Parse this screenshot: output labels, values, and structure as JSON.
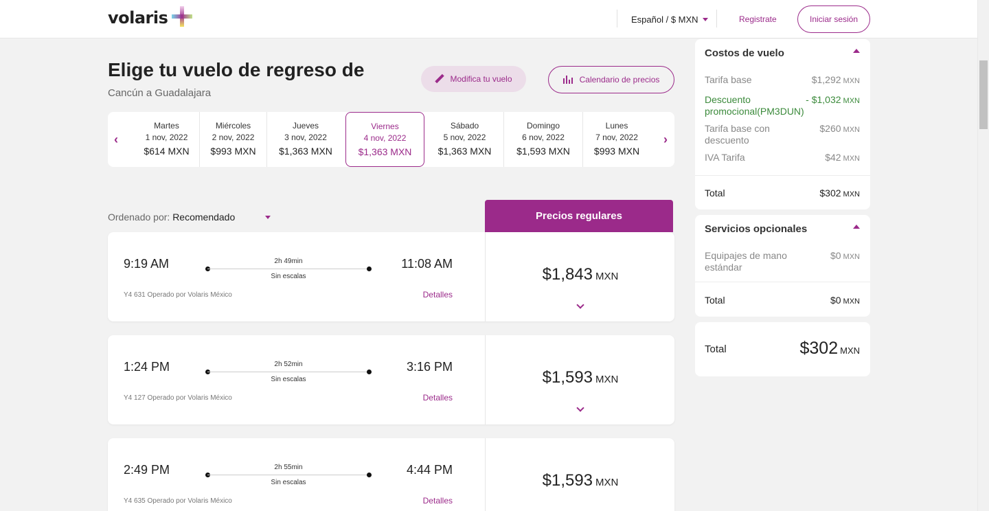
{
  "header": {
    "logo_text": "volaris",
    "language": "Español / $ MXN",
    "register": "Registrate",
    "login": "Iniciar sesión"
  },
  "page": {
    "title": "Elige tu vuelo de regreso de",
    "route": "Cancún a Guadalajara",
    "modify_btn": "Modifica tu vuelo",
    "calendar_btn": "Calendario de precios"
  },
  "dates": [
    {
      "day": "Martes",
      "date": "1 nov, 2022",
      "price": "$614 MXN"
    },
    {
      "day": "Miércoles",
      "date": "2 nov, 2022",
      "price": "$993 MXN"
    },
    {
      "day": "Jueves",
      "date": "3 nov, 2022",
      "price": "$1,363 MXN"
    },
    {
      "day": "Viernes",
      "date": "4 nov, 2022",
      "price": "$1,363 MXN"
    },
    {
      "day": "Sábado",
      "date": "5 nov, 2022",
      "price": "$1,363 MXN"
    },
    {
      "day": "Domingo",
      "date": "6 nov, 2022",
      "price": "$1,593 MXN"
    },
    {
      "day": "Lunes",
      "date": "7 nov, 2022",
      "price": "$993 MXN"
    }
  ],
  "sort": {
    "label": "Ordenado por:",
    "value": "Recomendado"
  },
  "fare_tab": "Precios regulares",
  "flights": [
    {
      "dep": "9:19 AM",
      "arr": "11:08 AM",
      "duration": "2h 49min",
      "stops": "Sin escalas",
      "operator": "Y4 631 Operado por Volaris México",
      "details": "Detalles",
      "price": "$1,843",
      "currency": "MXN"
    },
    {
      "dep": "1:24 PM",
      "arr": "3:16 PM",
      "duration": "2h 52min",
      "stops": "Sin escalas",
      "operator": "Y4 127 Operado por Volaris México",
      "details": "Detalles",
      "price": "$1,593",
      "currency": "MXN"
    },
    {
      "dep": "2:49 PM",
      "arr": "4:44 PM",
      "duration": "2h 55min",
      "stops": "Sin escalas",
      "operator": "Y4 635 Operado por Volaris México",
      "details": "Detalles",
      "price": "$1,593",
      "currency": "MXN"
    }
  ],
  "costs": {
    "title": "Costos de vuelo",
    "items": [
      {
        "label": "Tarifa base",
        "value": "$1,292",
        "cur": "MXN"
      },
      {
        "label": "Descuento promocional(PM3DUN)",
        "value": "- $1,032",
        "cur": "MXN"
      },
      {
        "label": "Tarifa base con descuento",
        "value": "$260",
        "cur": "MXN"
      },
      {
        "label": "IVA Tarifa",
        "value": "$42",
        "cur": "MXN"
      }
    ],
    "total_label": "Total",
    "total_value": "$302",
    "total_cur": "MXN"
  },
  "optional": {
    "title": "Servicios opcionales",
    "items": [
      {
        "label": "Equipajes de mano estándar",
        "value": "$0",
        "cur": "MXN"
      }
    ],
    "total_label": "Total",
    "total_value": "$0",
    "total_cur": "MXN"
  },
  "grand_total": {
    "label": "Total",
    "value": "$302",
    "cur": "MXN"
  }
}
